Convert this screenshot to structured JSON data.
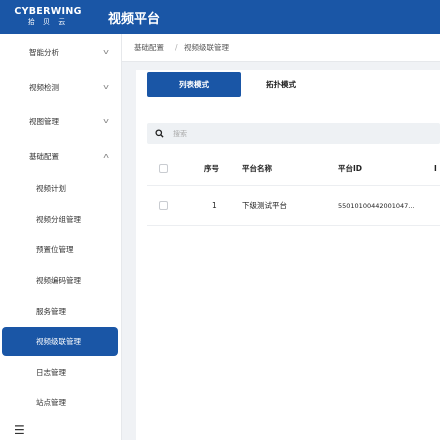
{
  "header": {
    "logo_brand": "CYBERWING",
    "logo_sub": "拾 贝 云",
    "app_title": "视频平台"
  },
  "sidebar": {
    "items": [
      {
        "label": "智能分析",
        "expandable": true,
        "expanded": false
      },
      {
        "label": "视频检测",
        "expandable": true,
        "expanded": false
      },
      {
        "label": "视图管理",
        "expandable": true,
        "expanded": false
      },
      {
        "label": "基础配置",
        "expandable": true,
        "expanded": true
      }
    ],
    "subitems": [
      {
        "label": "视频计划",
        "active": false
      },
      {
        "label": "视频分组管理",
        "active": false
      },
      {
        "label": "预置位管理",
        "active": false
      },
      {
        "label": "视频编码管理",
        "active": false
      },
      {
        "label": "服务管理",
        "active": false
      },
      {
        "label": "视频级联管理",
        "active": true
      },
      {
        "label": "日志管理",
        "active": false
      },
      {
        "label": "站点管理",
        "active": false
      }
    ],
    "collapse_icon": "☰"
  },
  "breadcrumb": {
    "items": [
      "基础配置",
      "视频级联管理"
    ],
    "separator": "/"
  },
  "tabs": {
    "active": "列表模式",
    "inactive": "拓扑模式"
  },
  "search": {
    "placeholder": "搜索",
    "value": ""
  },
  "table": {
    "headers": {
      "seq": "序号",
      "name": "平台名称",
      "id": "平台ID",
      "more": "",
      "more_cut": "I"
    },
    "rows": [
      {
        "seq": "1",
        "name": "下级测试平台",
        "id": "55010100442001047..."
      }
    ]
  },
  "colors": {
    "accent": "#1a56a6",
    "background": "#f0f2f5"
  }
}
